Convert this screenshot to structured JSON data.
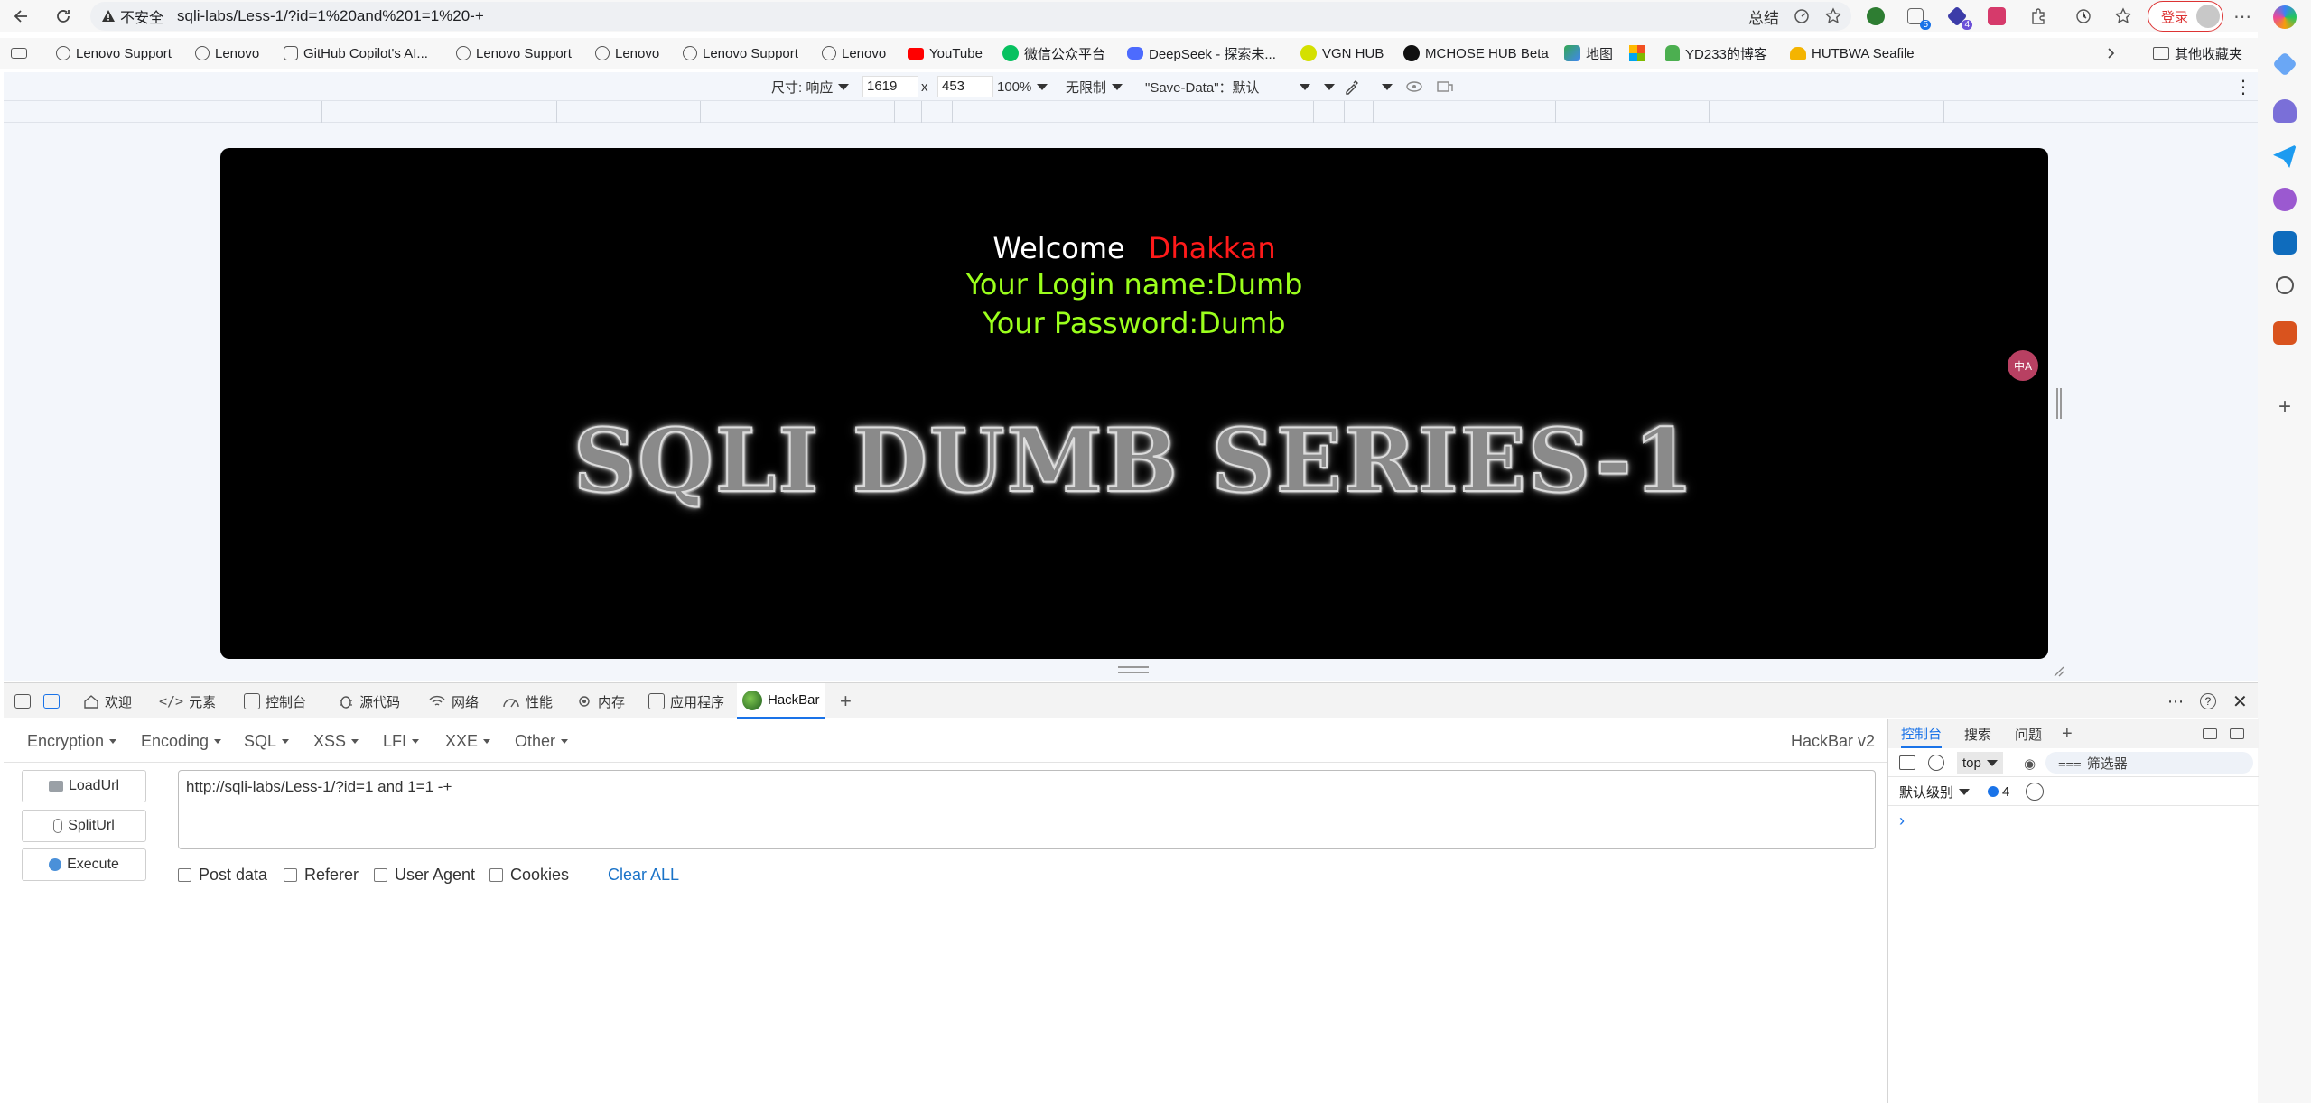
{
  "browser": {
    "security_label": "不安全",
    "url": "sqli-labs/Less-1/?id=1%20and%201=1%20-+",
    "summary_label": "总结",
    "login_label": "登录",
    "badges": {
      "ext1": "5",
      "ext2": "4"
    }
  },
  "bookmarks": [
    "Lenovo Support",
    "Lenovo",
    "GitHub Copilot's AI...",
    "Lenovo Support",
    "Lenovo",
    "Lenovo Support",
    "Lenovo",
    "YouTube",
    "微信公众平台",
    "DeepSeek - 探索未...",
    "VGN HUB",
    "MCHOSE HUB Beta",
    "地图",
    "YD233的博客",
    "HUTBWA Seafile"
  ],
  "bookmarks_other": "其他收藏夹",
  "device_toolbar": {
    "size_label": "尺寸: 响应",
    "width": "1619",
    "times": "x",
    "height": "453",
    "zoom": "100%",
    "throttle": "无限制",
    "save_data": "\"Save-Data\"：默认"
  },
  "page": {
    "welcome": "Welcome",
    "user": "Dhakkan",
    "login_name": "Your Login name:Dumb",
    "password": "Your Password:Dumb",
    "banner": "SQLI DUMB SERIES-1"
  },
  "devtools": {
    "tabs": [
      "欢迎",
      "元素",
      "控制台",
      "源代码",
      "网络",
      "性能",
      "内存",
      "应用程序",
      "HackBar"
    ],
    "active_tab": "HackBar"
  },
  "hackbar": {
    "menu": [
      "Encryption",
      "Encoding",
      "SQL",
      "XSS",
      "LFI",
      "XXE",
      "Other"
    ],
    "version": "HackBar v2",
    "buttons": [
      "LoadUrl",
      "SplitUrl",
      "Execute"
    ],
    "url_value": "http://sqli-labs/Less-1/?id=1 and 1=1 -+",
    "checkboxes": [
      "Post data",
      "Referer",
      "User Agent",
      "Cookies"
    ],
    "clear_all": "Clear ALL"
  },
  "console": {
    "tabs": [
      "控制台",
      "搜索",
      "问题"
    ],
    "context": "top",
    "filter_placeholder": "筛选器",
    "level": "默认级别",
    "message_count": "4"
  },
  "colors": {
    "welcome_user": "#ff1a1a",
    "login_text": "#9bff1c",
    "accent": "#1a73e8"
  }
}
